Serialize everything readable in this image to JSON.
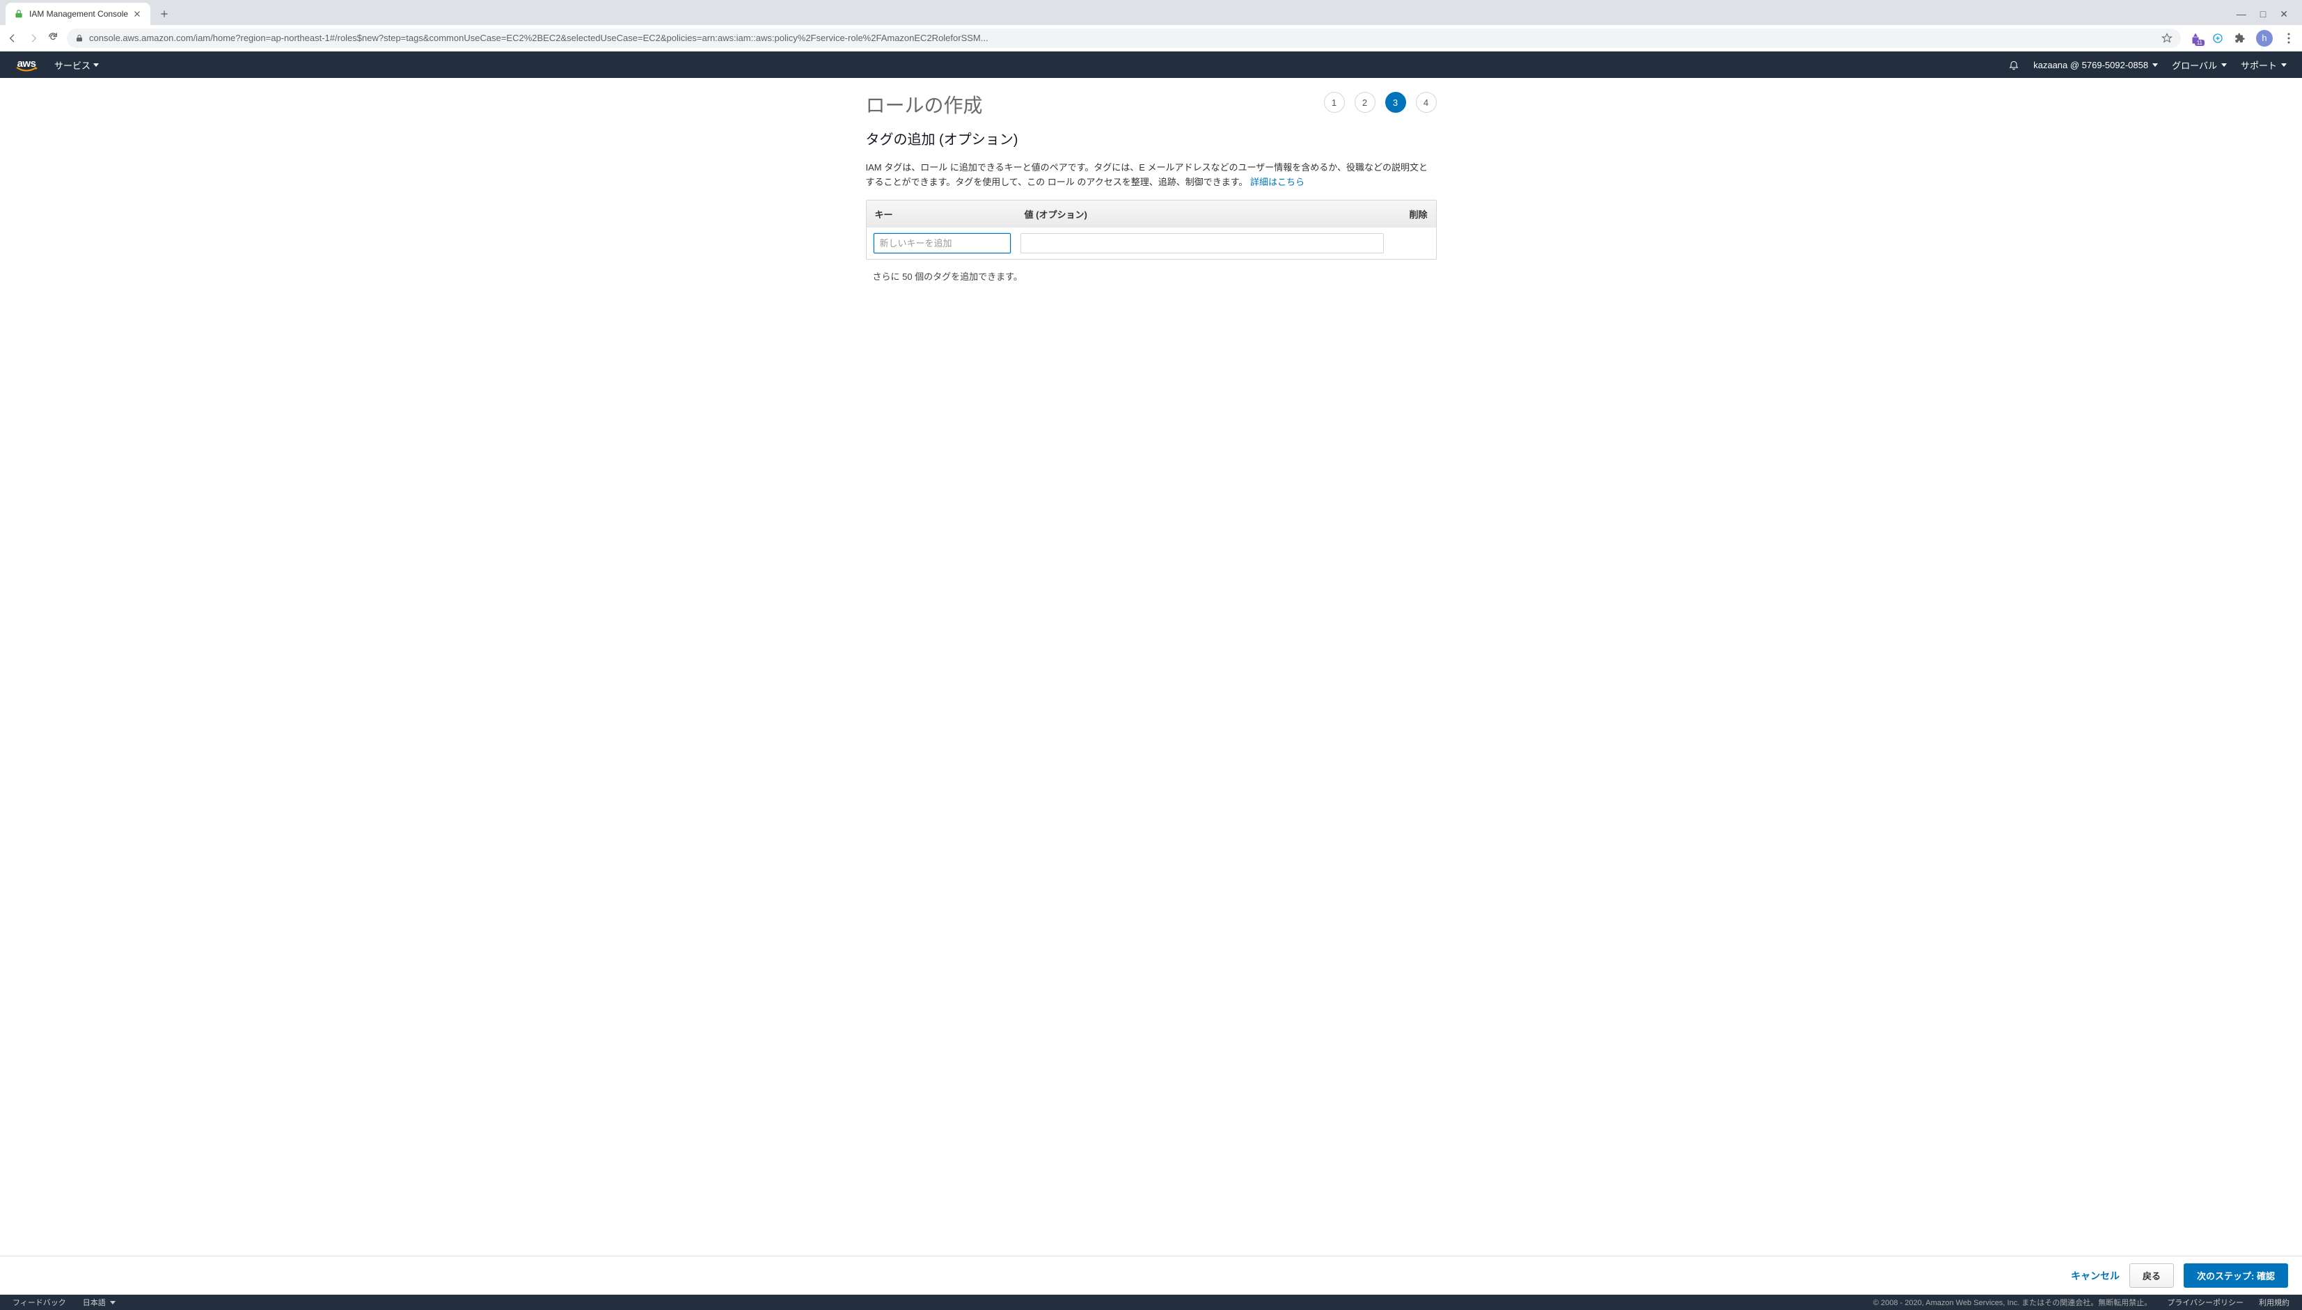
{
  "browser": {
    "tab_title": "IAM Management Console",
    "url": "console.aws.amazon.com/iam/home?region=ap-northeast-1#/roles$new?step=tags&commonUseCase=EC2%2BEC2&selectedUseCase=EC2&policies=arn:aws:iam::aws:policy%2Fservice-role%2FAmazonEC2RoleforSSM...",
    "ext_badge": "11",
    "avatar_letter": "h"
  },
  "header": {
    "logo": "aws",
    "services": "サービス",
    "account": "kazaana @ 5769-5092-0858",
    "region": "グローバル",
    "support": "サポート"
  },
  "page": {
    "title": "ロールの作成",
    "subtitle": "タグの追加 (オプション)",
    "description_part1": "IAM タグは、ロール に追加できるキーと値のペアです。タグには、E メールアドレスなどのユーザー情報を含めるか、役職などの説明文とすることができます。タグを使用して、この ロール のアクセスを整理、追跡、制御できます。 ",
    "learn_more": "詳細はこちら",
    "steps": [
      "1",
      "2",
      "3",
      "4"
    ],
    "active_step": 3
  },
  "table": {
    "header_key": "キー",
    "header_value": "値 (オプション)",
    "header_delete": "削除",
    "key_placeholder": "新しいキーを追加"
  },
  "remaining": "さらに 50 個のタグを追加できます。",
  "actions": {
    "cancel": "キャンセル",
    "back": "戻る",
    "next": "次のステップ: 確認"
  },
  "footer": {
    "feedback": "フィードバック",
    "language": "日本語",
    "copyright": "© 2008 - 2020, Amazon Web Services, Inc. またはその関連会社。無断転用禁止。",
    "privacy": "プライバシーポリシー",
    "terms": "利用規約"
  }
}
